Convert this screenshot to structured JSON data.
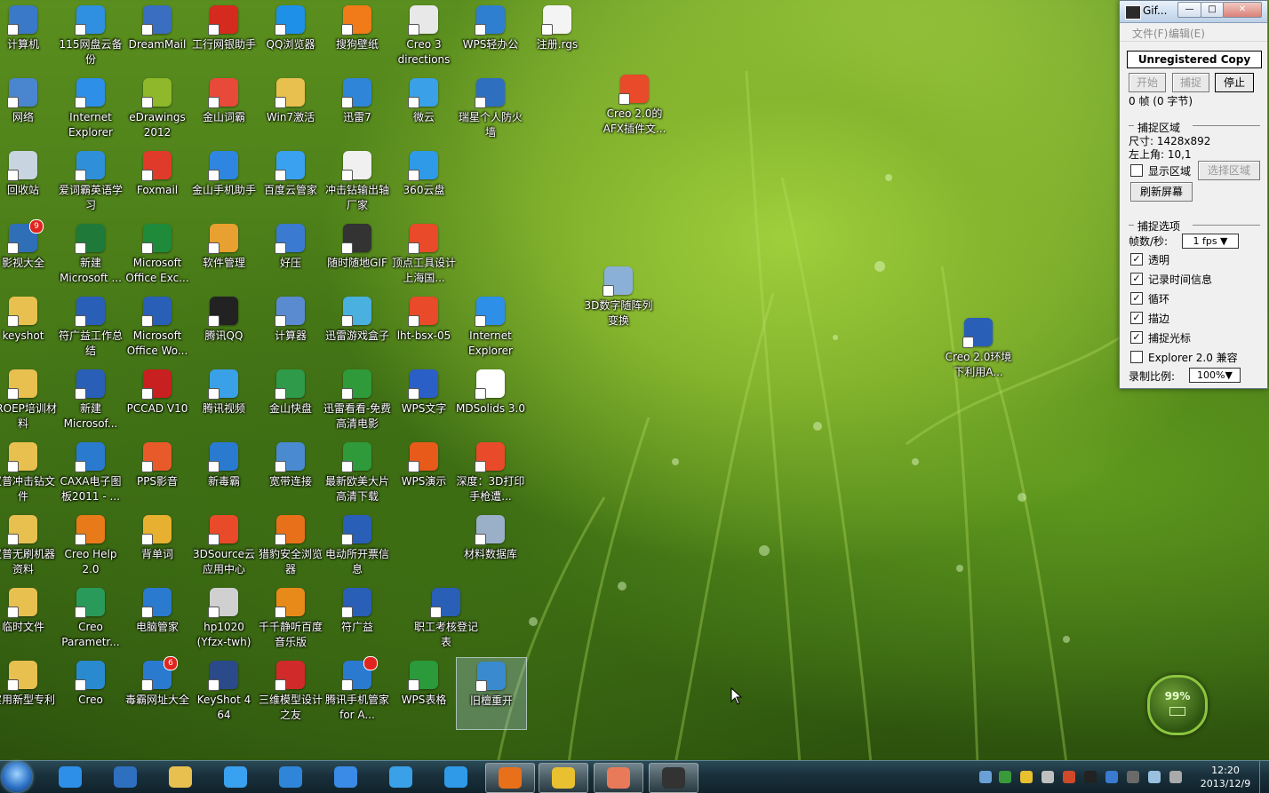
{
  "desktop": {
    "icons": [
      {
        "label": "计算机",
        "color": "#3a78c8"
      },
      {
        "label": "115网盘云备份",
        "color": "#2f8fe0"
      },
      {
        "label": "DreamMail",
        "color": "#3a6ec0"
      },
      {
        "label": "工行网银助手",
        "color": "#d52a1e"
      },
      {
        "label": "QQ浏览器",
        "color": "#1e90e8"
      },
      {
        "label": "搜狗壁纸",
        "color": "#f07b18"
      },
      {
        "label": "Creo 3 directions",
        "color": "#e8e8e8"
      },
      {
        "label": "WPS轻办公",
        "color": "#2f7fd0"
      },
      {
        "label": "注册.rgs",
        "color": "#f4f4f4"
      },
      {
        "label": "网络",
        "color": "#4a86d0"
      },
      {
        "label": "Internet Explorer",
        "color": "#2d8fe8"
      },
      {
        "label": "eDrawings 2012",
        "color": "#8fb82a"
      },
      {
        "label": "金山词霸",
        "color": "#e84a3a"
      },
      {
        "label": "Win7激活",
        "color": "#e8c050"
      },
      {
        "label": "迅雷7",
        "color": "#2f86d8"
      },
      {
        "label": "微云",
        "color": "#3aa0e8"
      },
      {
        "label": "瑞星个人防火墙",
        "color": "#2f6fc0"
      },
      {
        "label": "回收站",
        "color": "#c8d4e0"
      },
      {
        "label": "爱词霸英语学习",
        "color": "#2f8fd8"
      },
      {
        "label": "Foxmail",
        "color": "#e03a2a"
      },
      {
        "label": "金山手机助手",
        "color": "#2f86e0"
      },
      {
        "label": "百度云管家",
        "color": "#3aa0f0"
      },
      {
        "label": "冲击钻输出轴厂家",
        "color": "#f0f0f0"
      },
      {
        "label": "360云盘",
        "color": "#2f9ae8"
      },
      {
        "label": "影视大全",
        "color": "#2f6fb8"
      },
      {
        "label": "新建 Microsoft ...",
        "color": "#1f7a3a"
      },
      {
        "label": "Microsoft Office Exc...",
        "color": "#1f8a3a"
      },
      {
        "label": "软件管理",
        "color": "#e8a030"
      },
      {
        "label": "好压",
        "color": "#3a7ad0"
      },
      {
        "label": "随时随地GIF",
        "color": "#333333"
      },
      {
        "label": "顶点工具设计上海国...",
        "color": "#e84a2a"
      },
      {
        "label": "keyshot",
        "color": "#e8c050"
      },
      {
        "label": "符广益工作总结",
        "color": "#2a5fb8"
      },
      {
        "label": "Microsoft Office Wo...",
        "color": "#2a5fb8"
      },
      {
        "label": "腾讯QQ",
        "color": "#222222"
      },
      {
        "label": "计算器",
        "color": "#5a8ad0"
      },
      {
        "label": "迅雷游戏盒子",
        "color": "#4ab0e0"
      },
      {
        "label": "lht-bsx-05",
        "color": "#e84a2a"
      },
      {
        "label": "Internet Explorer",
        "color": "#2d8fe8"
      },
      {
        "label": "PROEP培训材料",
        "color": "#e8c050"
      },
      {
        "label": "新建 Microsof...",
        "color": "#2a5fb8"
      },
      {
        "label": "PCCAD V10",
        "color": "#c82020"
      },
      {
        "label": "腾讯视频",
        "color": "#3aa0e8"
      },
      {
        "label": "金山快盘",
        "color": "#2f9a4a"
      },
      {
        "label": "迅雷看看-免费高清电影",
        "color": "#2f9a3a"
      },
      {
        "label": "WPS文字",
        "color": "#2a5fc8"
      },
      {
        "label": "MDSolids 3.0",
        "color": "#ffffff"
      },
      {
        "label": "汉普冲击钻文件",
        "color": "#e8c050"
      },
      {
        "label": "CAXA电子图板2011 - ...",
        "color": "#2a7ad0"
      },
      {
        "label": "PPS影音",
        "color": "#e85a2a"
      },
      {
        "label": "新毒霸",
        "color": "#2a7ad0"
      },
      {
        "label": "宽带连接",
        "color": "#4a8ad0"
      },
      {
        "label": "最新欧美大片高清下载",
        "color": "#2f9a3a"
      },
      {
        "label": "WPS演示",
        "color": "#e85a1a"
      },
      {
        "label": "深度：3D打印手枪遭...",
        "color": "#e84a2a"
      },
      {
        "label": "汉普无刷机器资料",
        "color": "#e8c050"
      },
      {
        "label": "Creo Help 2.0",
        "color": "#e87a1a"
      },
      {
        "label": "背单词",
        "color": "#e8b030"
      },
      {
        "label": "3DSource云应用中心",
        "color": "#e84a2a"
      },
      {
        "label": "猎豹安全浏览器",
        "color": "#e8701a"
      },
      {
        "label": "电动所开票信息",
        "color": "#2a5fb8"
      },
      {
        "label": "材料数据库",
        "color": "#9ab0c8"
      },
      {
        "label": "临时文件",
        "color": "#e8c050"
      },
      {
        "label": "Creo Parametr...",
        "color": "#2a9a5a"
      },
      {
        "label": "电脑管家",
        "color": "#2a7ad0"
      },
      {
        "label": "hp1020 (Yfzx-twh)",
        "color": "#d0d0d0"
      },
      {
        "label": "千千静听百度音乐版",
        "color": "#e88a1a"
      },
      {
        "label": "符广益",
        "color": "#2a5fb8"
      },
      {
        "label": "职工考核登记表",
        "color": "#2a5fb8"
      },
      {
        "label": "实用新型专利",
        "color": "#e8c050"
      },
      {
        "label": "Creo",
        "color": "#2a8ad0"
      },
      {
        "label": "毒霸网址大全",
        "color": "#2a7ad0"
      },
      {
        "label": "KeyShot 4 64",
        "color": "#2a4a8a"
      },
      {
        "label": "三维模型设计之友",
        "color": "#d02a2a"
      },
      {
        "label": "腾讯手机管家 for A...",
        "color": "#2a7ad0"
      },
      {
        "label": "WPS表格",
        "color": "#2a9a3a"
      },
      {
        "label": "旧檀重开",
        "color": "#3a8ad0"
      },
      {
        "label": "Creo 2.0的AFX插件文...",
        "color": "#e84a2a"
      },
      {
        "label": "3D数字随阵列变换",
        "color": "#8ab0d8"
      },
      {
        "label": "Creo 2.0环境下利用A...",
        "color": "#2a5fb8"
      }
    ],
    "badges": {
      "影视大全": "9",
      "毒霸网址大全": "6",
      "腾讯手机管家 for A...": "1"
    }
  },
  "gif_window": {
    "title": "Gif...",
    "minimize": "—",
    "maximize": "□",
    "close": "✕",
    "menu": [
      "文件(F)",
      "编辑(E)"
    ],
    "unregistered": "Unregistered Copy",
    "buttons": {
      "start": "开始",
      "capture": "捕捉",
      "stop": "停止"
    },
    "frames": "0 帧 (0 字节)",
    "area_section": "捕捉区域",
    "size": "尺寸: 1428x892",
    "top_left": "左上角:  10,1",
    "show_area": "显示区域",
    "select_area": "选择区域",
    "refresh": "刷新屏幕",
    "options_section": "捕捉选项",
    "fps_label": "帧数/秒:",
    "fps_value": "1 fps",
    "options": [
      {
        "label": "透明",
        "checked": true
      },
      {
        "label": "记录时间信息",
        "checked": true
      },
      {
        "label": "循环",
        "checked": true
      },
      {
        "label": "描边",
        "checked": true
      },
      {
        "label": "捕捉光标",
        "checked": true
      },
      {
        "label": "Explorer 2.0 兼容",
        "checked": false
      }
    ],
    "scale_label": "录制比例:",
    "scale_value": "100%"
  },
  "battery": {
    "percent": "99%"
  },
  "taskbar": {
    "pinned": [
      {
        "name": "ie",
        "color": "#2d8fe8"
      },
      {
        "name": "firewall",
        "color": "#2f6fc0"
      },
      {
        "name": "explorer",
        "color": "#e8c050"
      },
      {
        "name": "baidu-cloud",
        "color": "#3aa0f0"
      },
      {
        "name": "thunder",
        "color": "#2f86d8"
      },
      {
        "name": "cloud",
        "color": "#3a8ae8"
      },
      {
        "name": "weiyun",
        "color": "#3aa0e8"
      },
      {
        "name": "360-cloud",
        "color": "#2f9ae8"
      },
      {
        "name": "cheetah",
        "color": "#e8701a"
      },
      {
        "name": "warning-app",
        "color": "#e8c030"
      },
      {
        "name": "qq-users",
        "color": "#e87a5a"
      },
      {
        "name": "gif-app",
        "color": "#333333"
      }
    ],
    "clock_time": "12:20",
    "clock_date": "2013/12/9"
  },
  "colors": {
    "taskbar": "#19303b",
    "accent": "#8cc63f"
  }
}
